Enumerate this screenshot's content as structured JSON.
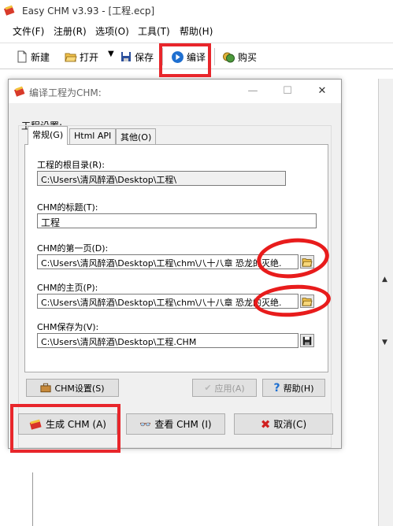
{
  "app": {
    "title": "Easy CHM v3.93 - [工程.ecp]"
  },
  "menu": [
    "文件(F)",
    "注册(R)",
    "选项(O)",
    "工具(T)",
    "帮助(H)"
  ],
  "toolbar": {
    "new_label": "新建",
    "open_label": "打开",
    "save_label": "保存",
    "compile_label": "编译",
    "buy_label": "购买"
  },
  "dialog": {
    "title": "编译工程为CHM:",
    "group_label": "工程设置:",
    "tabs": [
      "常规(G)",
      "Html API",
      "其他(O)"
    ],
    "root_dir_label": "工程的根目录(R):",
    "root_dir_value": "C:\\Users\\清风醉酒\\Desktop\\工程\\",
    "chm_title_label": "CHM的标题(T):",
    "chm_title_value": "工程",
    "first_page_label": "CHM的第一页(D):",
    "first_page_value": "C:\\Users\\清风醉酒\\Desktop\\工程\\chm\\八十八章 恐龙的灭绝.",
    "home_page_label": "CHM的主页(P):",
    "home_page_value": "C:\\Users\\清风醉酒\\Desktop\\工程\\chm\\八十八章 恐龙的灭绝.",
    "save_as_label": "CHM保存为(V):",
    "save_as_value": "C:\\Users\\清风醉酒\\Desktop\\工程.CHM",
    "chm_settings_label": "CHM设置(S)",
    "apply_label": "应用(A)",
    "help_label": "帮助(H)",
    "generate_label": "生成 CHM (A)",
    "view_label": "查看 CHM (I)",
    "cancel_label": "取消(C)"
  },
  "colors": {
    "annotation_red": "#e8262b",
    "compile_icon_blue": "#1e6fd0"
  }
}
